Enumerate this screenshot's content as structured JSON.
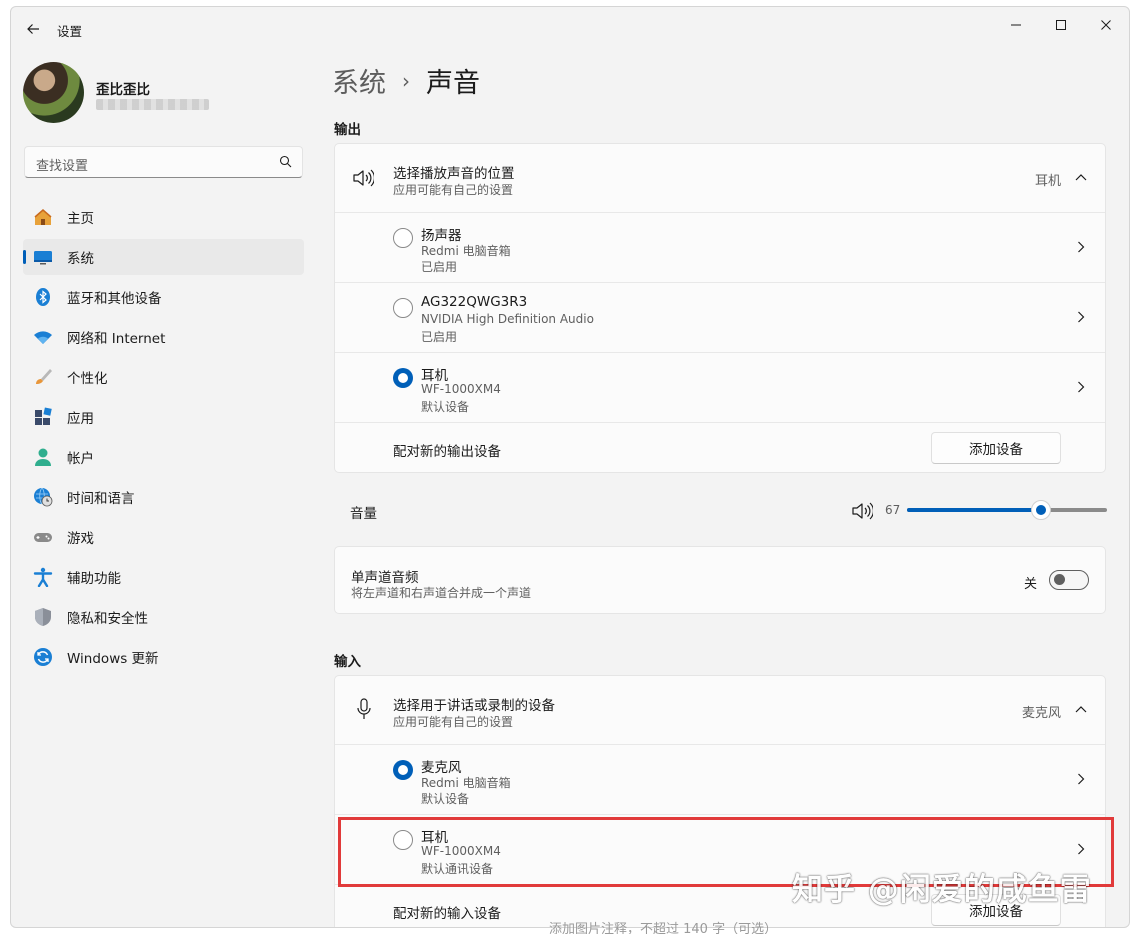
{
  "window": {
    "title": "设置"
  },
  "user": {
    "name": "歪比歪比"
  },
  "search": {
    "placeholder": "查找设置"
  },
  "sidebar": {
    "items": [
      {
        "label": "主页",
        "icon": "home-icon"
      },
      {
        "label": "系统",
        "icon": "system-icon",
        "active": true
      },
      {
        "label": "蓝牙和其他设备",
        "icon": "bluetooth-icon"
      },
      {
        "label": "网络和 Internet",
        "icon": "wifi-icon"
      },
      {
        "label": "个性化",
        "icon": "brush-icon"
      },
      {
        "label": "应用",
        "icon": "apps-icon"
      },
      {
        "label": "帐户",
        "icon": "account-icon"
      },
      {
        "label": "时间和语言",
        "icon": "globe-clock-icon"
      },
      {
        "label": "游戏",
        "icon": "gamepad-icon"
      },
      {
        "label": "辅助功能",
        "icon": "accessibility-icon"
      },
      {
        "label": "隐私和安全性",
        "icon": "shield-icon"
      },
      {
        "label": "Windows 更新",
        "icon": "update-icon"
      }
    ]
  },
  "breadcrumb": {
    "parent": "系统",
    "separator": "›",
    "current": "声音"
  },
  "output": {
    "section_title": "输出",
    "header": {
      "title": "选择播放声音的位置",
      "subtitle": "应用可能有自己的设置",
      "current": "耳机"
    },
    "devices": [
      {
        "name": "扬声器",
        "detail": "Redmi 电脑音箱",
        "status": "已启用",
        "selected": false
      },
      {
        "name": "AG322QWG3R3",
        "detail": "NVIDIA High Definition Audio",
        "status": "已启用",
        "selected": false
      },
      {
        "name": "耳机",
        "detail": "WF-1000XM4",
        "status": "默认设备",
        "selected": true
      }
    ],
    "pair": {
      "label": "配对新的输出设备",
      "button": "添加设备"
    }
  },
  "volume": {
    "label": "音量",
    "value": "67",
    "level": 0.67
  },
  "mono": {
    "title": "单声道音频",
    "subtitle": "将左声道和右声道合并成一个声道",
    "state": "关",
    "on": false
  },
  "input": {
    "section_title": "输入",
    "header": {
      "title": "选择用于讲话或录制的设备",
      "subtitle": "应用可能有自己的设置",
      "current": "麦克风"
    },
    "devices": [
      {
        "name": "麦克风",
        "detail": "Redmi 电脑音箱",
        "status": "默认设备",
        "selected": true
      },
      {
        "name": "耳机",
        "detail": "WF-1000XM4",
        "status": "默认通讯设备",
        "selected": false
      }
    ],
    "pair": {
      "label": "配对新的输入设备",
      "button": "添加设备"
    }
  },
  "overlay": {
    "watermark": "知乎 @闲爱的咸鱼雷",
    "cut_text": "添加图片注释，不超过 140 字（可选）"
  },
  "colors": {
    "accent": "#005fb8",
    "highlight": "#e13a3a"
  }
}
